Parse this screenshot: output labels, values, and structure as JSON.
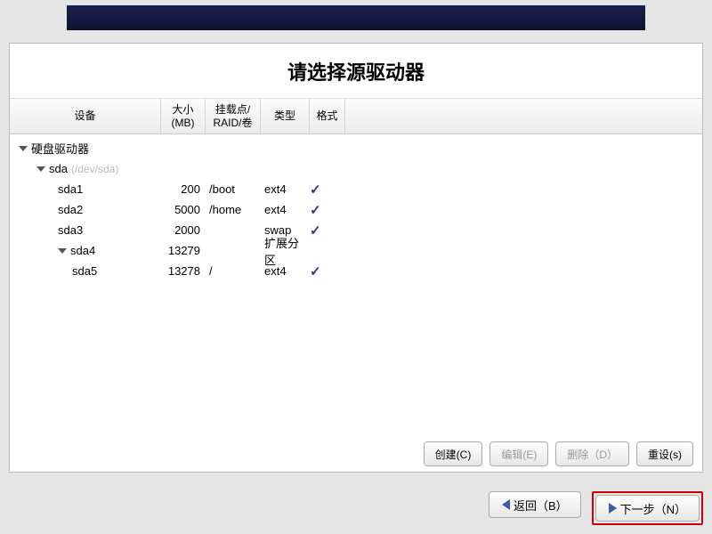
{
  "title": "请选择源驱动器",
  "columns": {
    "device": "设备",
    "size": "大小 (MB)",
    "mount": "挂载点/ RAID/卷",
    "type": "类型",
    "format": "格式"
  },
  "tree": {
    "root_label": "硬盘驱动器",
    "disk_label": "sda",
    "disk_path": "(/dev/sda)",
    "rows": [
      {
        "device": "sda1",
        "size": "200",
        "mount": "/boot",
        "type": "ext4",
        "format": true,
        "indent": "indent-2"
      },
      {
        "device": "sda2",
        "size": "5000",
        "mount": "/home",
        "type": "ext4",
        "format": true,
        "indent": "indent-2"
      },
      {
        "device": "sda3",
        "size": "2000",
        "mount": "",
        "type": "swap",
        "format": true,
        "indent": "indent-2"
      },
      {
        "device": "sda4",
        "size": "13279",
        "mount": "",
        "type": "扩展分区",
        "format": false,
        "indent": "indent-2",
        "expander": true
      },
      {
        "device": "sda5",
        "size": "13278",
        "mount": "/",
        "type": "ext4",
        "format": true,
        "indent": "indent-3"
      }
    ]
  },
  "buttons": {
    "create": "创建(C)",
    "edit": "编辑(E)",
    "delete": "删除（D）",
    "reset": "重设(s)",
    "back": "返回（B）",
    "next": "下一步（N）"
  }
}
